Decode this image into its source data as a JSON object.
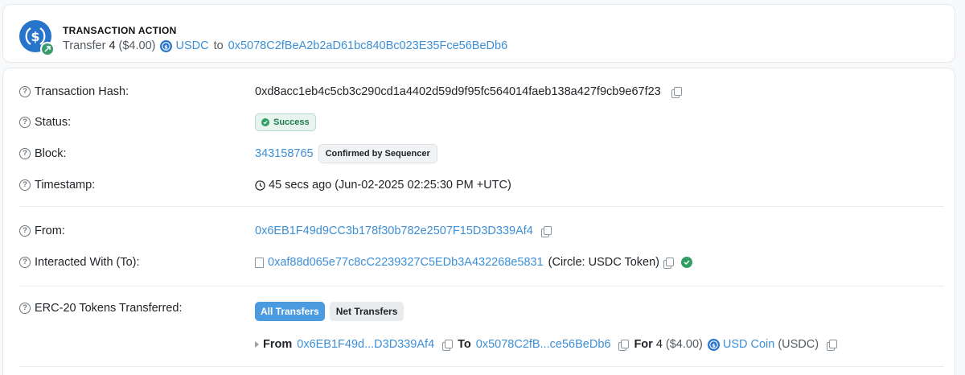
{
  "action": {
    "title": "TRANSACTION ACTION",
    "verb": "Transfer",
    "amount": "4",
    "usd": "($4.00)",
    "token": "USDC",
    "to_word": "to",
    "to_address": "0x5078C2fBeA2b2aD61bc840Bc023E35Fce56BeDb6"
  },
  "details": {
    "hash": {
      "label": "Transaction Hash:",
      "value": "0xd8acc1eb4c5cb3c290cd1a4402d59d9f95fc564014faeb138a427f9cb9e67f23"
    },
    "status": {
      "label": "Status:",
      "value": "Success"
    },
    "block": {
      "label": "Block:",
      "value": "343158765",
      "badge": "Confirmed by Sequencer"
    },
    "timestamp": {
      "label": "Timestamp:",
      "value": "45 secs ago (Jun-02-2025 02:25:30 PM +UTC)"
    },
    "from": {
      "label": "From:",
      "value": "0x6EB1F49d9CC3b178f30b782e2507F15D3D339Af4"
    },
    "interacted": {
      "label": "Interacted With (To):",
      "address": "0xaf88d065e77c8cC2239327C5EDb3A432268e5831",
      "name": "(Circle: USDC Token)"
    },
    "erc20": {
      "label": "ERC-20 Tokens Transferred:",
      "tab_all": "All Transfers",
      "tab_net": "Net Transfers",
      "transfer": {
        "from_word": "From",
        "from": "0x6EB1F49d...D3D339Af4",
        "to_word": "To",
        "to": "0x5078C2fB...ce56BeDb6",
        "for_word": "For",
        "amount": "4",
        "usd": "($4.00)",
        "token_name": "USD Coin",
        "token_symbol": "(USDC)"
      }
    }
  },
  "colors": {
    "link": "#3d8fd6",
    "success": "#2e9e65",
    "usdc": "#2775ca",
    "tab_active": "#4a9be0"
  }
}
